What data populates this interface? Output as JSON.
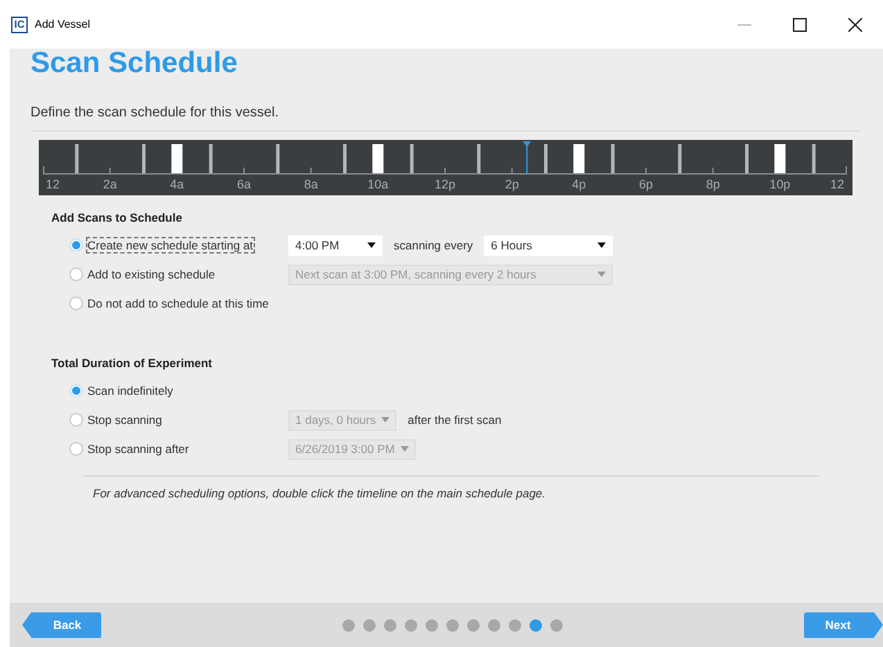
{
  "window": {
    "title": "Add Vessel",
    "app_icon": "IC"
  },
  "heading": "Scan Schedule",
  "description": "Define the scan schedule for this vessel.",
  "timeline": {
    "labels": [
      "12",
      "2a",
      "4a",
      "6a",
      "8a",
      "10a",
      "12p",
      "2p",
      "4p",
      "6p",
      "8p",
      "10p",
      "12"
    ],
    "now_marker": {
      "level": 0.602
    },
    "hours": [
      {
        "kind": "tick"
      },
      {
        "kind": "bar"
      },
      {
        "kind": "tick"
      },
      {
        "kind": "bar"
      },
      {
        "kind": "scan"
      },
      {
        "kind": "bar"
      },
      {
        "kind": "tick"
      },
      {
        "kind": "bar"
      },
      {
        "kind": "tick"
      },
      {
        "kind": "bar"
      },
      {
        "kind": "scan"
      },
      {
        "kind": "bar"
      },
      {
        "kind": "tick"
      },
      {
        "kind": "bar"
      },
      {
        "kind": "tick"
      },
      {
        "kind": "bar"
      },
      {
        "kind": "scan"
      },
      {
        "kind": "bar"
      },
      {
        "kind": "tick"
      },
      {
        "kind": "bar"
      },
      {
        "kind": "tick"
      },
      {
        "kind": "bar"
      },
      {
        "kind": "scan"
      },
      {
        "kind": "bar"
      },
      {
        "kind": "tick"
      }
    ]
  },
  "add_scans": {
    "title": "Add Scans to Schedule",
    "options": [
      {
        "label": "Create new schedule starting at",
        "selected": true,
        "focused": true,
        "controls": [
          {
            "kind": "select",
            "value": "4:00 PM",
            "disabled": false
          },
          {
            "kind": "text",
            "text": "scanning every"
          },
          {
            "kind": "select",
            "value": "6 Hours",
            "disabled": false,
            "wide": true
          }
        ]
      },
      {
        "label": "Add to existing schedule",
        "selected": false,
        "focused": false,
        "controls": [
          {
            "kind": "select",
            "value": "Next scan at 3:00 PM, scanning every 2 hours",
            "disabled": true,
            "wide": true
          }
        ]
      },
      {
        "label": "Do not add to schedule at this time",
        "selected": false,
        "focused": false
      }
    ]
  },
  "duration": {
    "title": "Total Duration of Experiment",
    "options": [
      {
        "label": "Scan indefinitely",
        "selected": true,
        "focused": false
      },
      {
        "label": "Stop scanning",
        "selected": false,
        "focused": false,
        "controls": [
          {
            "kind": "select",
            "value": "1 days, 0 hours",
            "disabled": true
          },
          {
            "kind": "text",
            "text": "after the first scan"
          }
        ]
      },
      {
        "label": "Stop scanning after",
        "selected": false,
        "focused": false,
        "controls": [
          {
            "kind": "select",
            "value": "6/26/2019 3:00 PM",
            "disabled": true
          }
        ]
      }
    ]
  },
  "note": "For advanced scheduling options, double click the timeline on the main schedule page.",
  "footer": {
    "back": "Back",
    "next": "Next",
    "steps": [
      {
        "selected": false
      },
      {
        "selected": false
      },
      {
        "selected": false
      },
      {
        "selected": false
      },
      {
        "selected": false
      },
      {
        "selected": false
      },
      {
        "selected": false
      },
      {
        "selected": false
      },
      {
        "selected": false
      },
      {
        "selected": true
      },
      {
        "selected": false
      }
    ]
  }
}
